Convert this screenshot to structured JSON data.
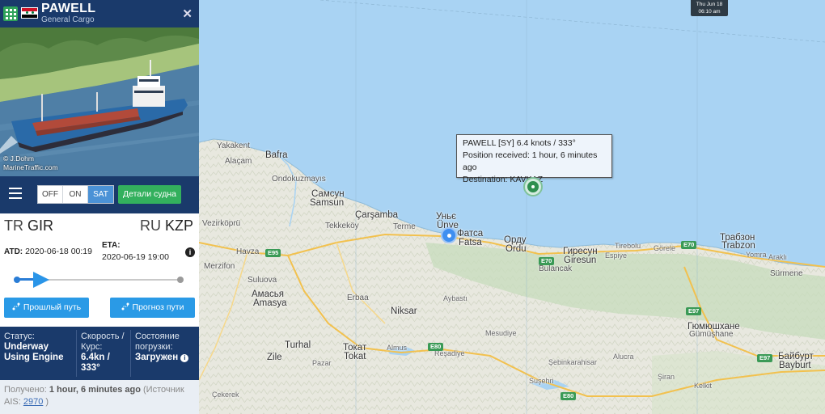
{
  "vessel": {
    "name": "PAWELL",
    "type": "General Cargo",
    "photo_credit": "© J.Dohm",
    "photo_site": "MarineTraffic.com"
  },
  "toolbar": {
    "toggle": [
      "OFF",
      "ON",
      "SAT"
    ],
    "toggle_active": "SAT",
    "details_label": "Детали судна"
  },
  "route": {
    "departure_country": "TR",
    "departure_port": "GIR",
    "arrival_country": "RU",
    "arrival_port": "KZP",
    "atd_label": "ATD:",
    "atd_value": "2020-06-18 00:19",
    "eta_label": "ETA:",
    "eta_value": "2020-06-19 19:00",
    "progress": 0.18,
    "past_label": "Прошлый путь",
    "forecast_label": "Прогноз пути"
  },
  "status": {
    "status_label": "Статус:",
    "status_value": "Underway Using Engine",
    "speed_label": "Скорость / Курс:",
    "speed_value": "6.4kn / 333°",
    "load_label": "Состояние погрузки:",
    "load_value": "Загружен"
  },
  "received": {
    "prefix": "Получено:",
    "time": "1 hour, 6 minutes ago",
    "source_prefix": "(Источник AIS:",
    "source_id": "2970",
    "suffix": ")"
  },
  "map": {
    "tooltip_line1": "PAWELL [SY] 6.4 knots / 333°",
    "tooltip_line2": "Position received: 1 hour, 6 minutes ago",
    "tooltip_line3": "Destination: KAVKAZ",
    "timestamp_day": "Thu Jun 18",
    "timestamp_time": "06:10 am",
    "places": {
      "yakakent": "Yakakent",
      "bafra": "Bafra",
      "alacam": "Alaçam",
      "ondokuzmayis": "Ondokuzmayıs",
      "samsun_ru": "Самсун",
      "samsun": "Samsun",
      "carsamba": "Çarşamba",
      "tekkekoy": "Tekkeköy",
      "terme": "Terme",
      "unye_ru": "Уньє",
      "unye": "Ünye",
      "fatsa_ru": "Фатса",
      "fatsa": "Fatsa",
      "ordu_ru": "Орду",
      "ordu": "Ordu",
      "giresun_ru": "Гиресун",
      "giresun": "Giresun",
      "tirebolu": "Tirebolu",
      "espiye": "Espiye",
      "gorele": "Görele",
      "trabzon_ru": "Трабзон",
      "trabzon": "Trabzon",
      "yomra": "Yomra",
      "arakli": "Araklı",
      "surmene": "Sürmene",
      "vezirkopru": "Vezirköprü",
      "havza": "Havza",
      "merzifon": "Merzifon",
      "suluova": "Suluova",
      "amasya_ru": "Амасья",
      "amasya": "Amasya",
      "erbaa": "Erbaa",
      "niksar": "Niksar",
      "aybasti": "Aybastı",
      "bulancak": "Bulancak",
      "mesudiye": "Mesudiye",
      "gumushane_ru": "Гюмюшхане",
      "gumushane": "Gümüşhane",
      "turhal": "Turhal",
      "tokat_ru": "Токат",
      "tokat": "Tokat",
      "almus": "Almus",
      "resadiye": "Reşadiye",
      "zile": "Zile",
      "pazar": "Pazar",
      "sebinkarahisar": "Şebinkarahisar",
      "alucra": "Alucra",
      "siran": "Şiran",
      "kelkit": "Kelkit",
      "susehri": "Suşehri",
      "bayburt_ru": "Байбурт",
      "bayburt": "Bayburt",
      "cekerek": "Çekerek"
    },
    "highways": {
      "e95": "E95",
      "e70a": "E70",
      "e70b": "E70",
      "e97a": "E97",
      "e97b": "E97",
      "e80a": "E80",
      "e80b": "E80"
    }
  }
}
